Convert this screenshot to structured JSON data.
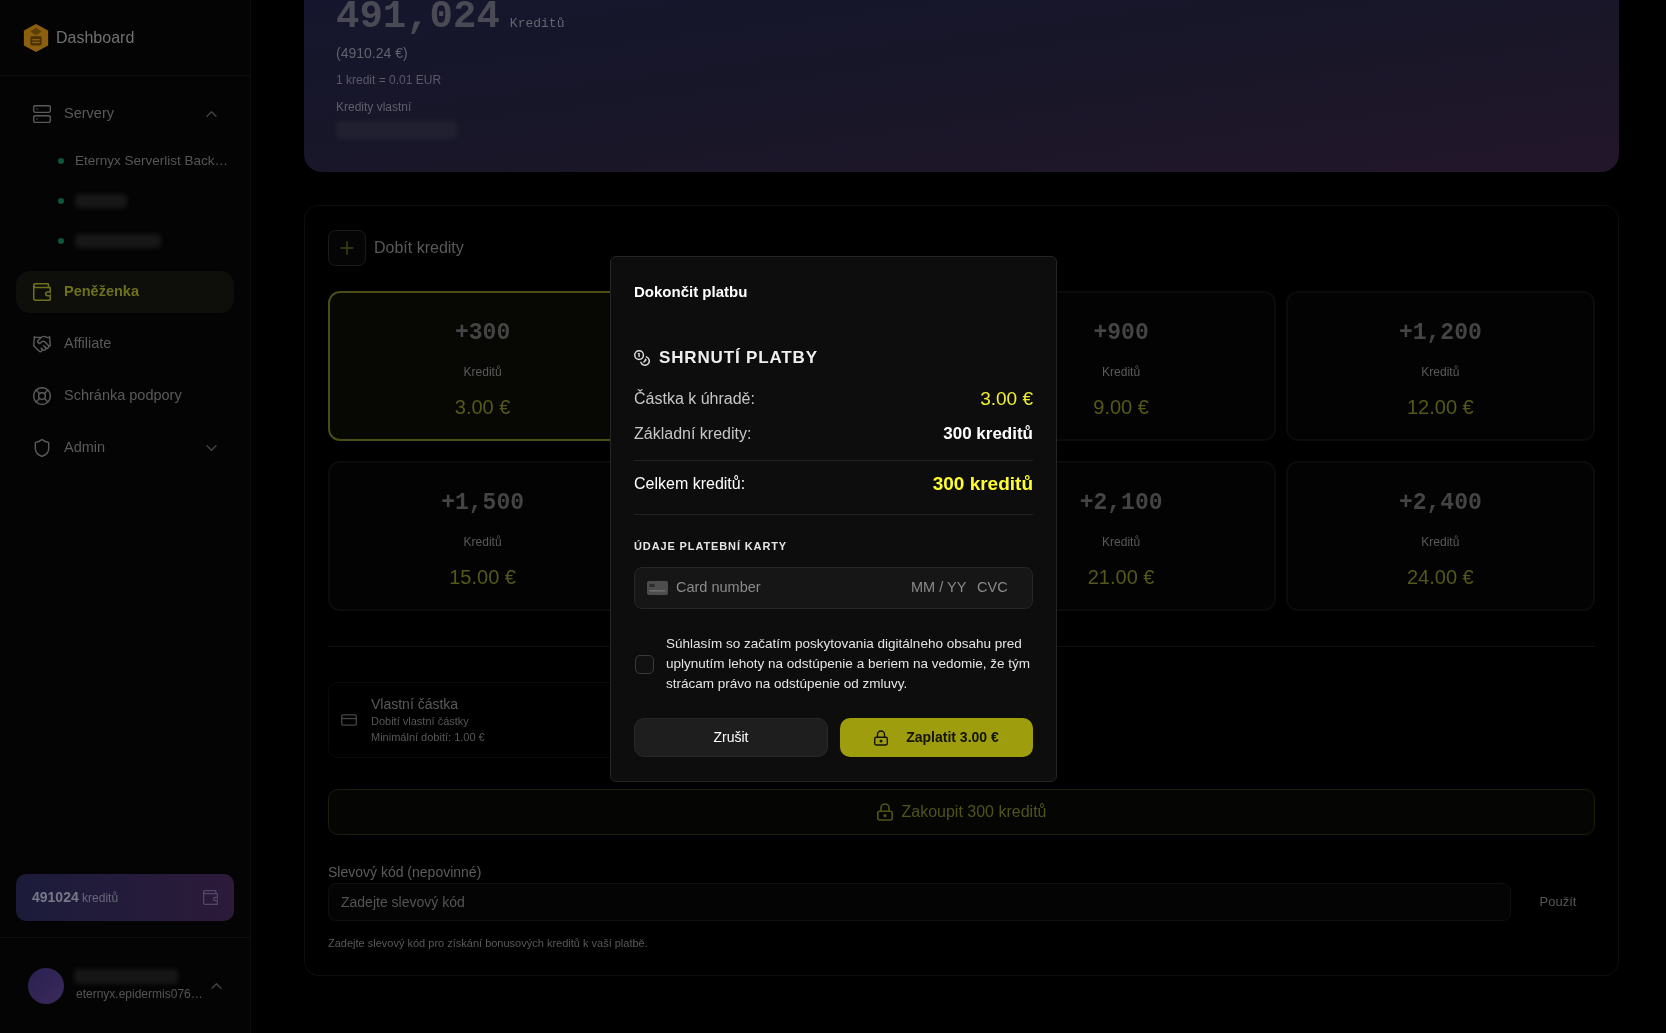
{
  "sidebar": {
    "brand": "Dashboard",
    "nav": [
      {
        "kind": "group",
        "label": "Servery",
        "selected": false,
        "expanded": true,
        "children": [
          {
            "label": "Eternyx Serverlist Back…",
            "color": "#0e5538",
            "redacted": false
          },
          {
            "color": "#0e5538",
            "redacted": true
          },
          {
            "color": "#0e5538",
            "redacted": true
          }
        ]
      },
      {
        "kind": "link",
        "label": "Peněženka",
        "selected": true
      },
      {
        "kind": "link",
        "label": "Affiliate",
        "selected": false
      },
      {
        "kind": "link",
        "label": "Schránka podpory",
        "selected": false
      },
      {
        "kind": "group",
        "label": "Admin",
        "selected": false,
        "expanded": false
      }
    ],
    "balance": {
      "amount": "491024",
      "unit": "kreditů"
    },
    "user": {
      "email": "eternyx.epidermis076…"
    }
  },
  "banner": {
    "amount": "491,024",
    "unit": "Kreditů",
    "euro": "(4910.24 €)",
    "rate": "1 kredit = 0.01 EUR",
    "owned_label": "Kredity vlastní"
  },
  "topup": {
    "title": "Dobít kredity",
    "packs": [
      {
        "credits": "+300",
        "unit": "Kreditů",
        "price": "3.00 €",
        "selected": true
      },
      {
        "credits": "+900",
        "unit": "Kreditů",
        "price": "9.00 €",
        "selected": false
      },
      {
        "credits": "+1,200",
        "unit": "Kreditů",
        "price": "12.00 €",
        "selected": false
      },
      {
        "credits": "+1,500",
        "unit": "Kreditů",
        "price": "15.00 €",
        "selected": false
      },
      {
        "credits": "+2,100",
        "unit": "Kreditů",
        "price": "21.00 €",
        "selected": false
      },
      {
        "credits": "+2,400",
        "unit": "Kreditů",
        "price": "24.00 €",
        "selected": false
      }
    ],
    "custom": {
      "title": "Vlastní částka",
      "subtitle": "Dobití vlastní částky",
      "minimum": "Minimální dobití: 1.00 €"
    },
    "buy_button": "Zakoupit 300 kreditů",
    "discount": {
      "label": "Slevový kód (nepovinné)",
      "placeholder": "Zadejte slevový kód",
      "apply": "Použít",
      "hint": "Zadejte slevový kód pro získání bonusových kreditů k vaší platbě."
    }
  },
  "dialog": {
    "title": "Dokončit platbu",
    "summary_title": "SHRNUTÍ PLATBY",
    "rows": [
      {
        "kind": "amount",
        "label": "Částka k úhradě:",
        "value": "3.00 €"
      },
      {
        "kind": "plain",
        "label": "Základní kredity:",
        "value": "300 kreditů"
      },
      {
        "kind": "total",
        "label": "Celkem kreditů:",
        "value": "300 kreditů"
      }
    ],
    "card_section": "ÚDAJE PLATEBNÍ KARTY",
    "card": {
      "placeholder": "Card number",
      "expiry_placeholder": "MM / YY",
      "cvc_placeholder": "CVC"
    },
    "consent": {
      "text": "Súhlasím so začatím poskytovania digitálneho obsahu pred uplynutím lehoty na odstúpenie a beriem na vedomie, že tým strácam právo na odstúpenie od zmluvy.",
      "checked": false
    },
    "cancel": "Zrušit",
    "pay": "Zaplatit 3.00 €"
  }
}
